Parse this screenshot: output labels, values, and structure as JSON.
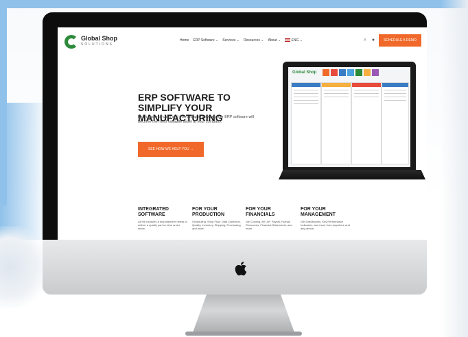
{
  "site": {
    "logo_title": "Global Shop",
    "logo_subtitle": "SOLUTIONS",
    "nav": [
      "Home",
      "ERP Software ⌄",
      "Services ⌄",
      "Resources ⌄",
      "About ⌄"
    ],
    "lang": "ENG ⌄",
    "cta_top": "SCHEDULE A DEMO",
    "hero_heading": "ERP SOFTWARE TO SIMPLIFY YOUR MANUFACTURING",
    "hero_text": "From quote-to-cash and everything in between, our ERP software will become the most valuable asset at your company.",
    "hero_button": "SEE HOW WE HELP YOU →",
    "columns": [
      {
        "heading": "INTEGRATED SOFTWARE",
        "text": "All the modules a manufacturer needs to deliver a quality part on time and a return."
      },
      {
        "heading": "FOR YOUR PRODUCTION",
        "text": "Scheduling, Shop Floor Data Collection, Quality, Inventory, Shipping, Purchasing, and more."
      },
      {
        "heading": "FOR YOUR FINANCIALS",
        "text": "Job Costing, AR, AP, Payroll, Human Resources, Financial Statements, and more."
      },
      {
        "heading": "FOR YOUR MANAGEMENT",
        "text": "Get Dashboards, Key Performance Indicators, and more from anywhere and any device."
      }
    ]
  },
  "laptop": {
    "logo": "Global Shop"
  },
  "colors": {
    "brand_orange": "#f0692a",
    "brand_green": "#2c8a3a",
    "bezel": "#0d0d0d"
  },
  "icons": {
    "search": "search-icon",
    "user": "user-icon",
    "apple": "apple-logo-icon"
  }
}
